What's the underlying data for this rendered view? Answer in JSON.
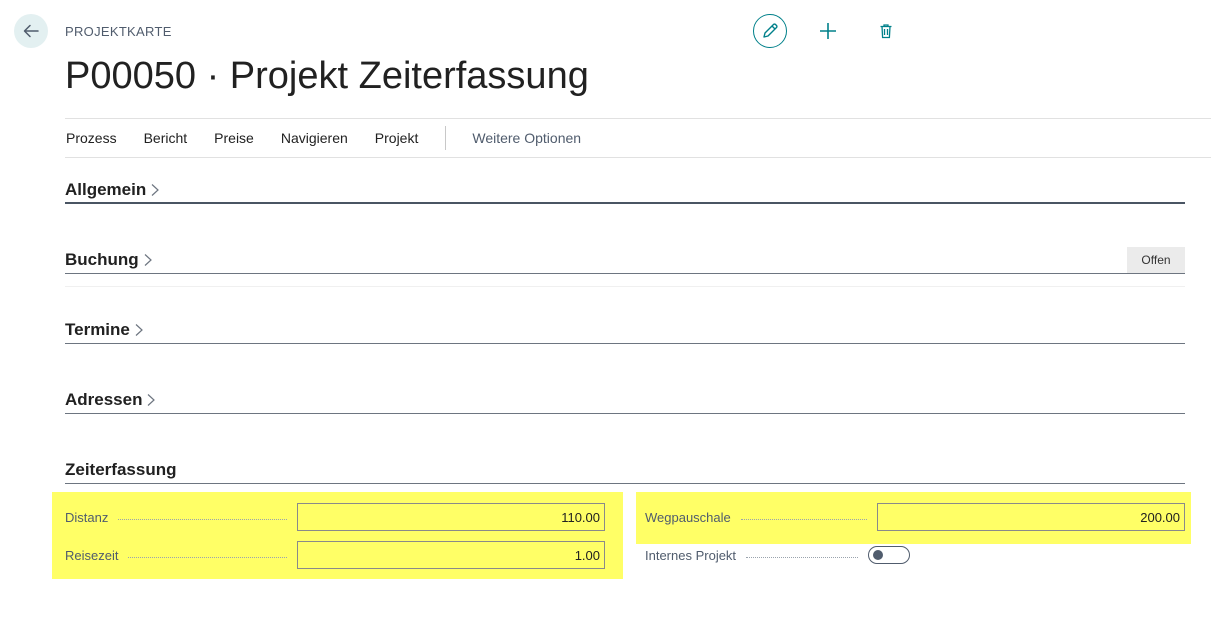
{
  "header": {
    "caption": "PROJEKTKARTE",
    "title": "P00050 · Projekt Zeiterfassung"
  },
  "icons": {
    "back": "arrow-left-icon",
    "edit": "pencil-icon",
    "new": "plus-icon",
    "delete": "trash-icon",
    "accent_color": "#00808a"
  },
  "actionbar": {
    "items": [
      "Prozess",
      "Bericht",
      "Preise",
      "Navigieren",
      "Projekt"
    ],
    "more": "Weitere Optionen"
  },
  "sections": {
    "allgemein": "Allgemein",
    "buchung": "Buchung",
    "buchung_status": "Offen",
    "termine": "Termine",
    "adressen": "Adressen",
    "zeiterfassung": "Zeiterfassung"
  },
  "fields": {
    "distanz": {
      "label": "Distanz",
      "value": "110.00"
    },
    "reisezeit": {
      "label": "Reisezeit",
      "value": "1.00"
    },
    "wegpauschale": {
      "label": "Wegpauschale",
      "value": "200.00"
    },
    "internes_projekt": {
      "label": "Internes Projekt",
      "value": "off"
    }
  },
  "highlight_color": "#ffff66"
}
